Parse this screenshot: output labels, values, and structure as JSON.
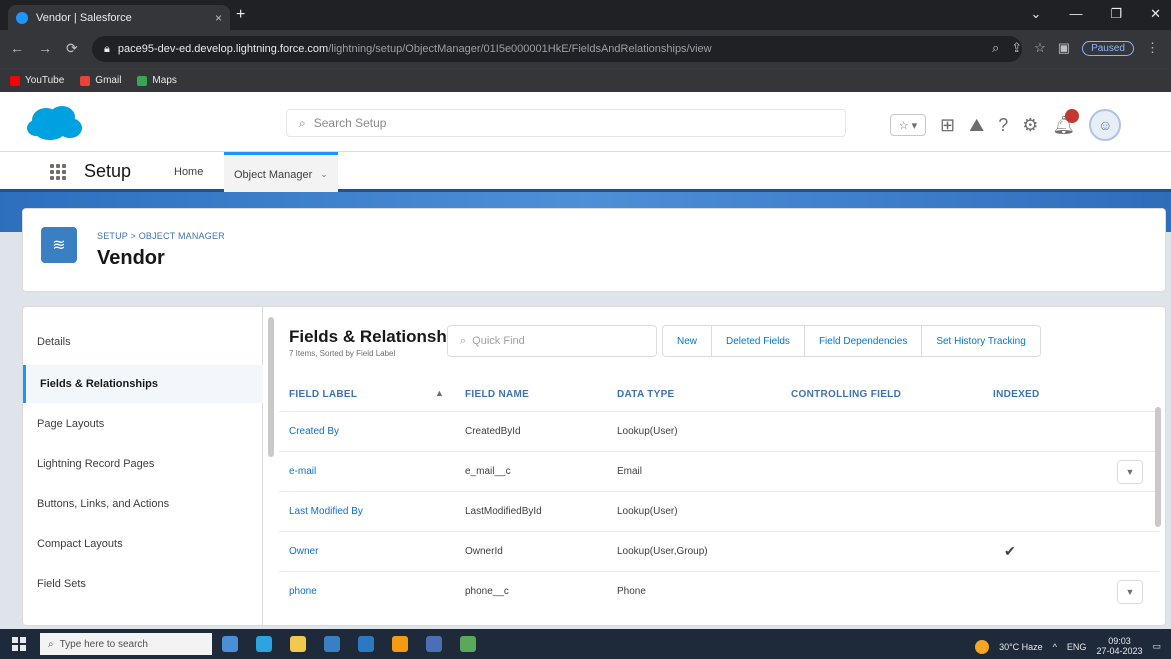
{
  "browser": {
    "tab_title": "Vendor | Salesforce",
    "tab_close": "×",
    "new_tab": "+",
    "window_controls": [
      "⌄",
      "—",
      "❐",
      "✕"
    ],
    "url_host": "pace95-dev-ed.develop.lightning.force.com",
    "url_path": "/lightning/setup/ObjectManager/01I5e000001HkE/FieldsAndRelationships/view",
    "profile_status": "Paused",
    "bookmarks": [
      {
        "label": "YouTube",
        "color": "#ff0000"
      },
      {
        "label": "Gmail",
        "color": "#ea4335"
      },
      {
        "label": "Maps",
        "color": "#34a853"
      }
    ]
  },
  "header": {
    "search_placeholder": "Search Setup",
    "help_icon": "?",
    "settings_icon": "⚙"
  },
  "app_nav": {
    "app_name": "Setup",
    "home": "Home",
    "object_manager": "Object Manager",
    "chevron": "⌄"
  },
  "object": {
    "breadcrumb": "SETUP > OBJECT MANAGER",
    "title": "Vendor"
  },
  "sidebar": {
    "items": [
      {
        "label": "Details"
      },
      {
        "label": "Fields & Relationships"
      },
      {
        "label": "Page Layouts"
      },
      {
        "label": "Lightning Record Pages"
      },
      {
        "label": "Buttons, Links, and Actions"
      },
      {
        "label": "Compact Layouts"
      },
      {
        "label": "Field Sets"
      }
    ]
  },
  "content": {
    "title": "Fields & Relationships",
    "subtitle": "7 Items, Sorted by Field Label",
    "quick_find_placeholder": "Quick Find",
    "buttons": [
      "New",
      "Deleted Fields",
      "Field Dependencies",
      "Set History Tracking"
    ],
    "columns": [
      "FIELD LABEL",
      "FIELD NAME",
      "DATA TYPE",
      "CONTROLLING FIELD",
      "INDEXED"
    ],
    "sort_indicator": "▲",
    "rows": [
      {
        "label": "Created By",
        "name": "CreatedById",
        "type": "Lookup(User)",
        "controlling": "",
        "indexed": "",
        "menu": false
      },
      {
        "label": "e-mail",
        "name": "e_mail__c",
        "type": "Email",
        "controlling": "",
        "indexed": "",
        "menu": true
      },
      {
        "label": "Last Modified By",
        "name": "LastModifiedById",
        "type": "Lookup(User)",
        "controlling": "",
        "indexed": "",
        "menu": false
      },
      {
        "label": "Owner",
        "name": "OwnerId",
        "type": "Lookup(User,Group)",
        "controlling": "",
        "indexed": "✔",
        "menu": false
      },
      {
        "label": "phone",
        "name": "phone__c",
        "type": "Phone",
        "controlling": "",
        "indexed": "",
        "menu": true
      }
    ]
  },
  "taskbar": {
    "search_placeholder": "Type here to search",
    "weather": "30°C Haze",
    "time": "09:03",
    "date": "27-04-2023",
    "lang": "ENG",
    "apps": [
      {
        "name": "task-view",
        "color": "#4a90d9"
      },
      {
        "name": "edge",
        "color": "#2ca4e0"
      },
      {
        "name": "file-explorer",
        "color": "#f2c94c"
      },
      {
        "name": "store",
        "color": "#3a7fc1"
      },
      {
        "name": "mail",
        "color": "#2b79c2"
      },
      {
        "name": "vlc",
        "color": "#f39c12"
      },
      {
        "name": "media",
        "color": "#4b6fb5"
      },
      {
        "name": "chrome",
        "color": "#5ba85b"
      }
    ]
  }
}
